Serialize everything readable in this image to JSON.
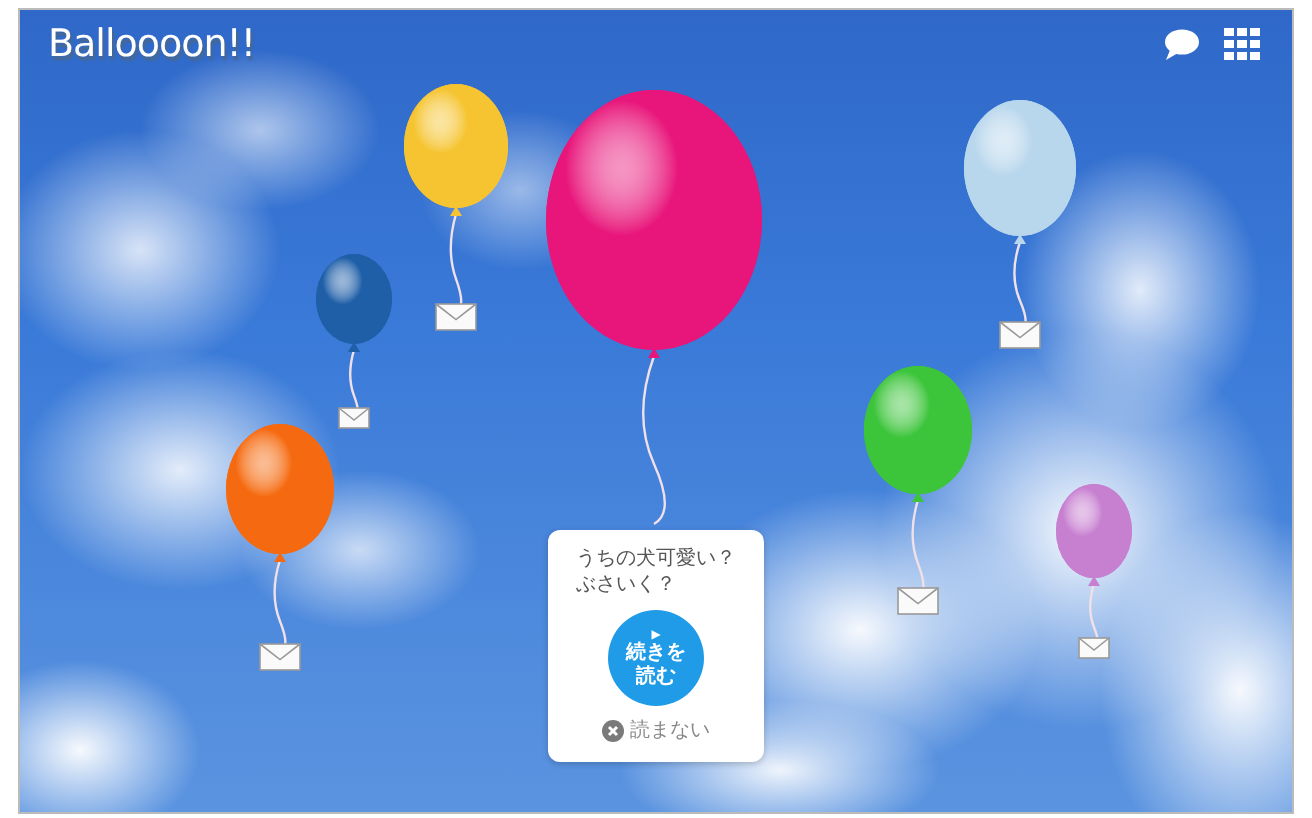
{
  "app": {
    "title": "Balloooon!!"
  },
  "balloons": [
    {
      "color": "#f5c430",
      "letter": true
    },
    {
      "color": "#1f5fa8",
      "letter": true
    },
    {
      "color": "#f56a10",
      "letter": true
    },
    {
      "color": "#e8157a",
      "letter": false
    },
    {
      "color": "#b8d6ec",
      "letter": true
    },
    {
      "color": "#3cc43a",
      "letter": true
    },
    {
      "color": "#c77fd0",
      "letter": true
    }
  ],
  "message_card": {
    "lines": [
      "うちの犬可愛い？",
      "ぶさいく？"
    ],
    "read_button": {
      "icon": "▶",
      "lines": [
        "続きを",
        "読む"
      ]
    },
    "dismiss": "読まない"
  }
}
